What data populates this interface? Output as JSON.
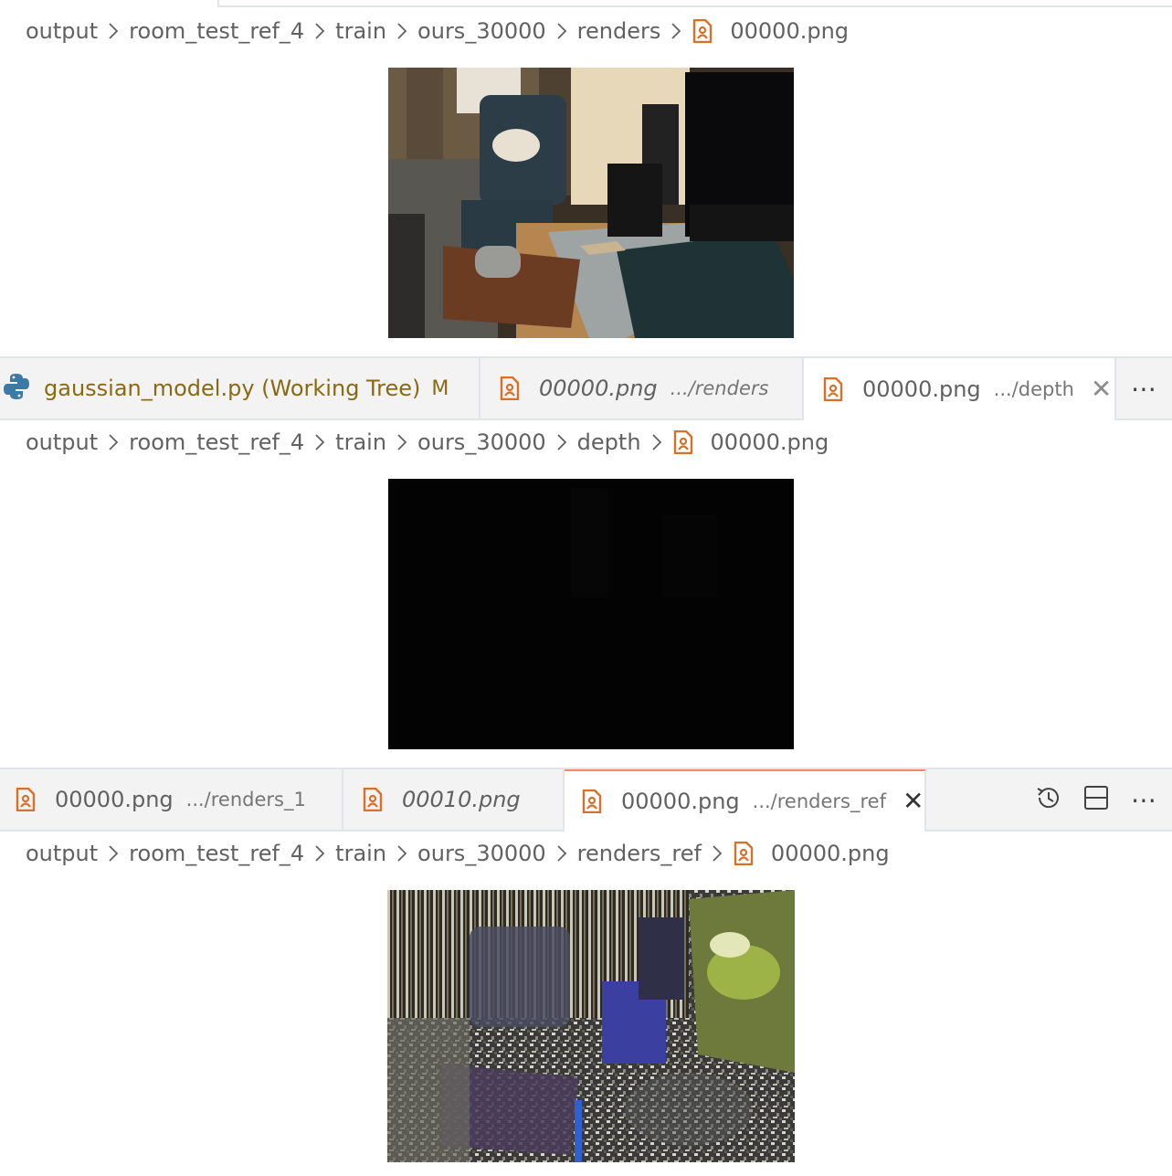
{
  "group1": {
    "breadcrumb": {
      "items": [
        "output",
        "room_test_ref_4",
        "train",
        "ours_30000",
        "renders"
      ],
      "file": "00000.png"
    }
  },
  "group2": {
    "tabs": [
      {
        "label": "gaussian_model.py (Working Tree)",
        "flag": "M",
        "icon": "python-icon"
      },
      {
        "label": "00000.png",
        "desc": ".../renders",
        "icon": "image-file-icon"
      },
      {
        "label": "00000.png",
        "desc": ".../depth",
        "icon": "image-file-icon",
        "close": "✕"
      }
    ],
    "more": "⋯",
    "breadcrumb": {
      "items": [
        "output",
        "room_test_ref_4",
        "train",
        "ours_30000",
        "depth"
      ],
      "file": "00000.png"
    }
  },
  "group3": {
    "tabs": [
      {
        "label": "00000.png",
        "desc": ".../renders_1",
        "icon": "image-file-icon"
      },
      {
        "label": "00010.png",
        "icon": "image-file-icon"
      },
      {
        "label": "00000.png",
        "desc": ".../renders_ref",
        "icon": "image-file-icon",
        "close": "✕"
      }
    ],
    "more": "⋯",
    "breadcrumb": {
      "items": [
        "output",
        "room_test_ref_4",
        "train",
        "ours_30000",
        "renders_ref"
      ],
      "file": "00000.png"
    }
  },
  "icons": {
    "chevron": "chevron-right-icon",
    "history": "history-icon",
    "split": "split-editor-icon",
    "more": "more-actions-icon"
  },
  "colors": {
    "accent": "#f08a67",
    "modified": "#8a6a11",
    "image_icon": "#d5712b"
  }
}
